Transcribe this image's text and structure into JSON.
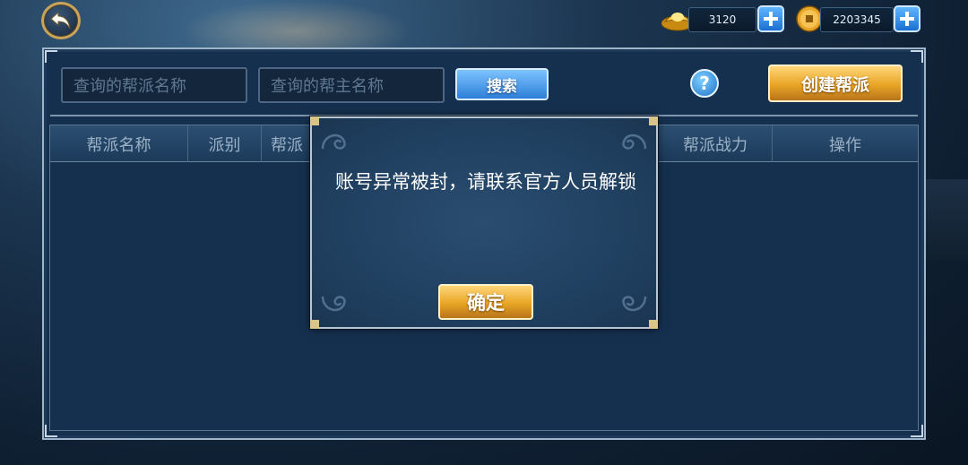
{
  "currencies": {
    "gold_ingot": {
      "icon": "gold-ingot-icon",
      "value": "3120"
    },
    "coin": {
      "icon": "copper-coin-icon",
      "value": "2203345"
    }
  },
  "search": {
    "guild_name_placeholder": "查询的帮派名称",
    "leader_name_placeholder": "查询的帮主名称",
    "search_label": "搜索",
    "help_label": "?",
    "create_label": "创建帮派"
  },
  "table": {
    "headers": [
      "帮派名称",
      "派别",
      "帮派",
      "帮派战力",
      "操作"
    ]
  },
  "modal": {
    "message": "账号异常被封，请联系官方人员解锁",
    "ok_label": "确定"
  },
  "colors": {
    "panel": "#15304f",
    "gold_button": "#e8a525",
    "blue_button": "#2d7ed8"
  }
}
